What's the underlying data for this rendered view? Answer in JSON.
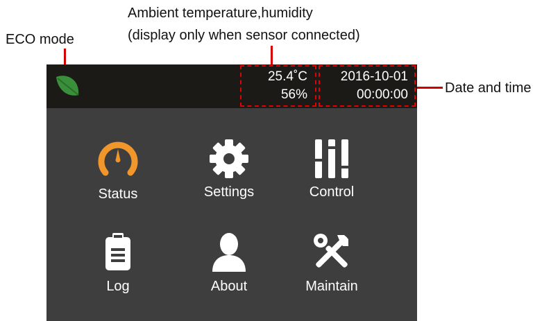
{
  "annotations": {
    "ambient_line1": "Ambient temperature,humidity",
    "ambient_line2": "(display only when sensor connected)",
    "eco_mode": "ECO mode",
    "date_time": "Date and time"
  },
  "status_bar": {
    "temperature": "25.4˚C",
    "humidity": "56%",
    "date": "2016-10-01",
    "time": "00:00:00",
    "eco_icon": "leaf-icon",
    "eco_color": "#3a8f3a"
  },
  "menu": {
    "items": [
      {
        "label": "Status",
        "icon": "gauge-icon",
        "color": "#f0962a"
      },
      {
        "label": "Settings",
        "icon": "gear-icon",
        "color": "#ffffff"
      },
      {
        "label": "Control",
        "icon": "sliders-icon",
        "color": "#ffffff"
      },
      {
        "label": "Log",
        "icon": "clipboard-icon",
        "color": "#ffffff"
      },
      {
        "label": "About",
        "icon": "person-icon",
        "color": "#ffffff"
      },
      {
        "label": "Maintain",
        "icon": "tools-icon",
        "color": "#ffffff"
      }
    ]
  },
  "colors": {
    "annotation_red": "#e60000",
    "screen_bg": "#3e3e3e",
    "statusbar_bg": "#1c1a17"
  }
}
